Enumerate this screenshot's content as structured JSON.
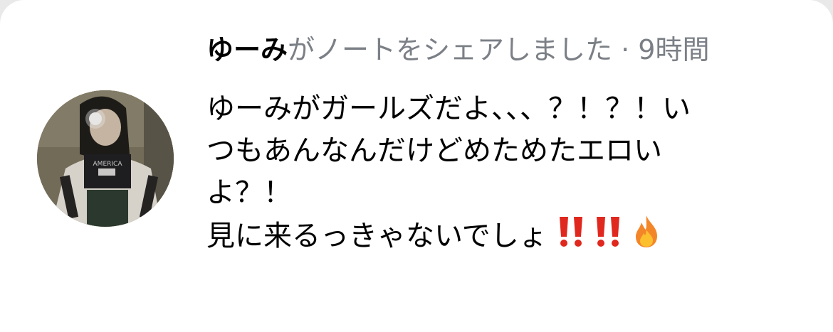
{
  "note": {
    "username": "ゆーみ",
    "action_text": "がノートをシェアしました",
    "separator": " · ",
    "time": "9時間",
    "body_lines": [
      "ゆーみがガールズだよ、、、？！？！い",
      "つもあんなんだけどめためたエロい",
      "よ？！",
      "見に来るっきゃないでしょ"
    ],
    "emojis": [
      "double-exclamation-icon",
      "double-exclamation-icon",
      "fire-icon"
    ],
    "colors": {
      "text": "#000000",
      "meta": "#7b7f86",
      "emoji_red": "#e0281e",
      "fire_orange": "#f4862a"
    }
  }
}
